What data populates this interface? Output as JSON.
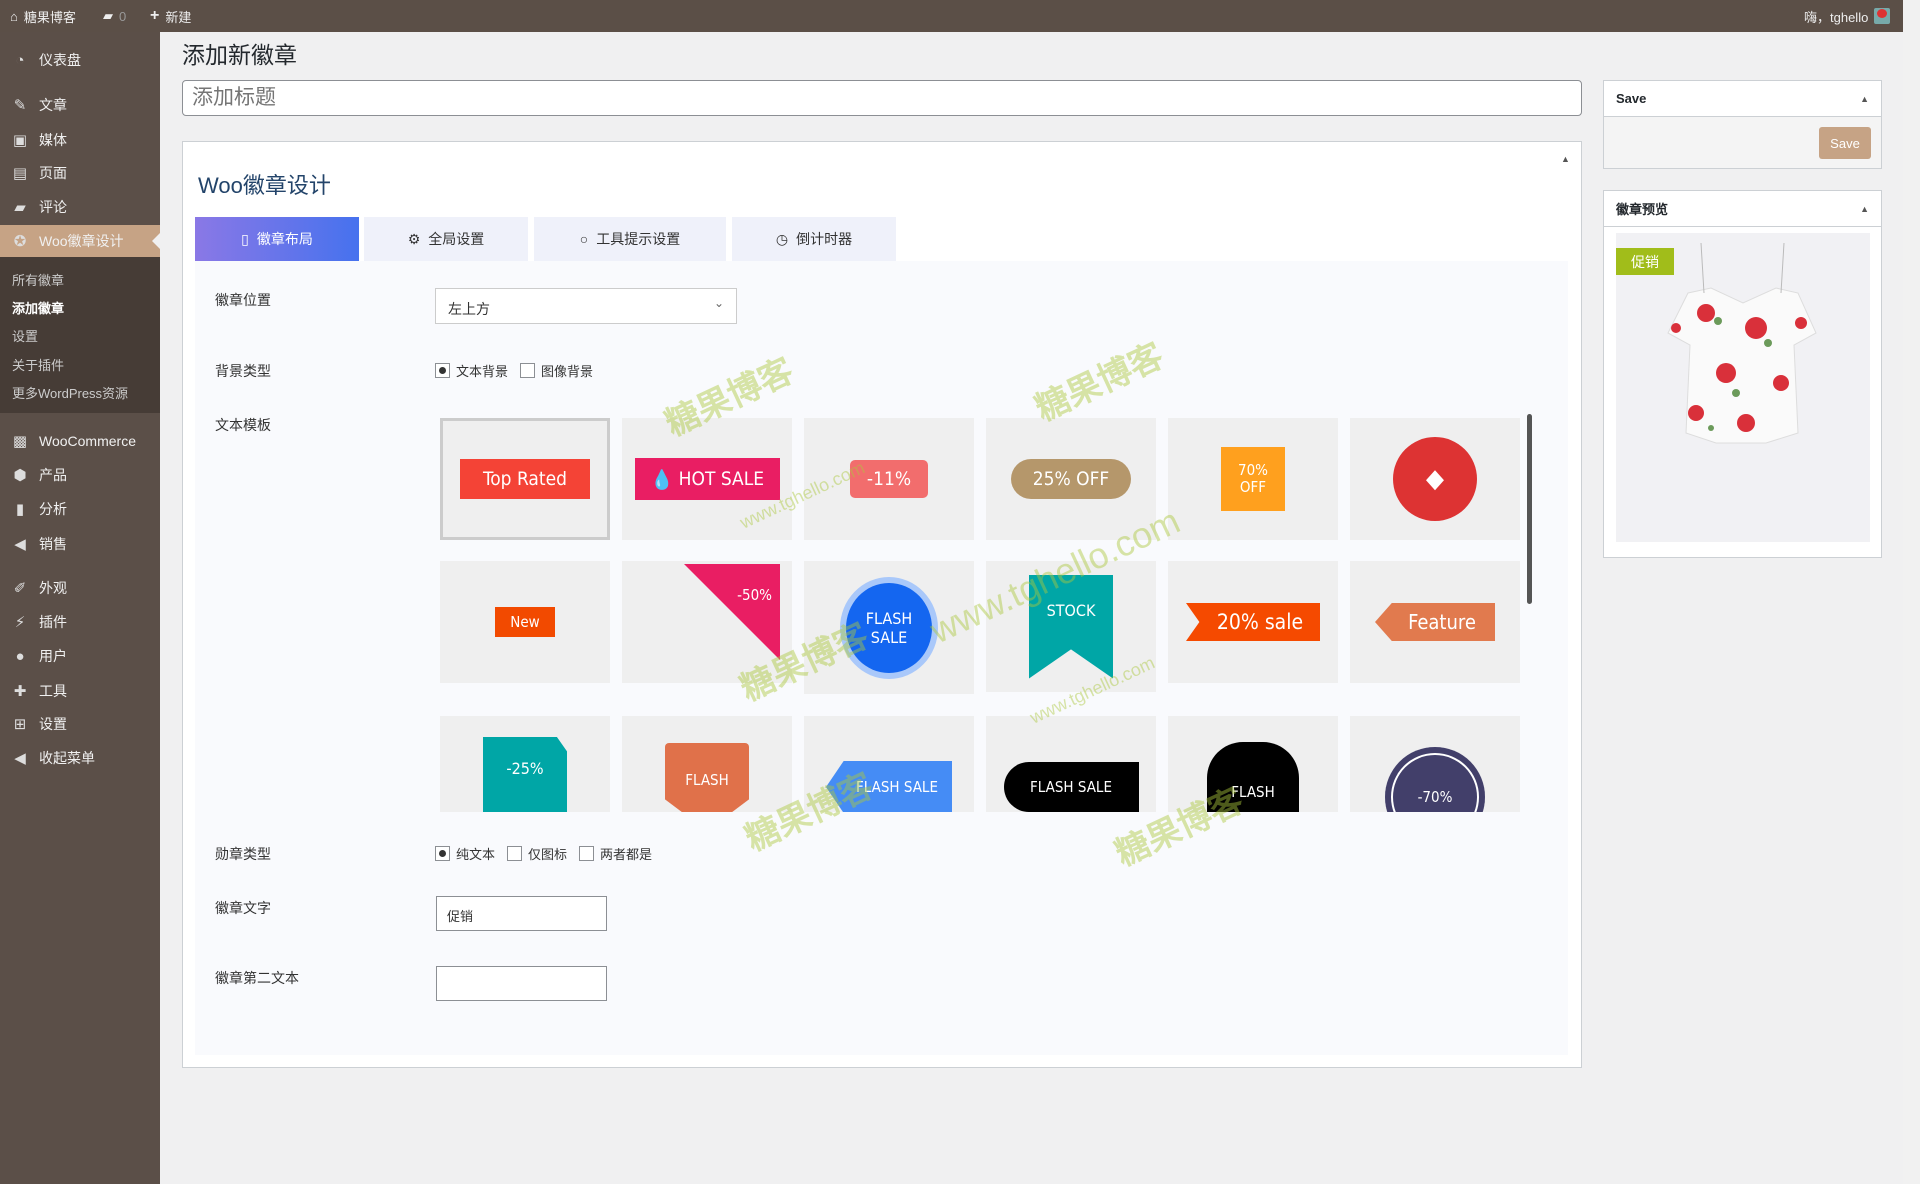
{
  "adminbar": {
    "site": "糖果博客",
    "comments": "0",
    "new": "新建",
    "greeting": "嗨，tghello"
  },
  "sidebar": {
    "items": [
      {
        "label": "仪表盘",
        "icon": "dashboard-icon",
        "glyph": "◔"
      },
      {
        "label": "文章",
        "icon": "pin-icon",
        "glyph": "✎"
      },
      {
        "label": "媒体",
        "icon": "media-icon",
        "glyph": "▣"
      },
      {
        "label": "页面",
        "icon": "page-icon",
        "glyph": "▤"
      },
      {
        "label": "评论",
        "icon": "comment-icon",
        "glyph": "▰"
      },
      {
        "label": "Woo徽章设计",
        "icon": "award-icon",
        "glyph": "✪"
      },
      {
        "label": "WooCommerce",
        "icon": "woo-icon",
        "glyph": "▩"
      },
      {
        "label": "产品",
        "icon": "box-icon",
        "glyph": "⬢"
      },
      {
        "label": "分析",
        "icon": "bar-chart-icon",
        "glyph": "▮"
      },
      {
        "label": "销售",
        "icon": "megaphone-icon",
        "glyph": "◀"
      },
      {
        "label": "外观",
        "icon": "brush-icon",
        "glyph": "✐"
      },
      {
        "label": "插件",
        "icon": "plugin-icon",
        "glyph": "⚡"
      },
      {
        "label": "用户",
        "icon": "user-icon",
        "glyph": "●"
      },
      {
        "label": "工具",
        "icon": "wrench-icon",
        "glyph": "✚"
      },
      {
        "label": "设置",
        "icon": "settings-icon",
        "glyph": "⊞"
      },
      {
        "label": "收起菜单",
        "icon": "collapse-icon",
        "glyph": "◀"
      }
    ],
    "submenu": [
      "所有徽章",
      "添加徽章",
      "设置",
      "关于插件",
      "更多WordPress资源"
    ]
  },
  "page": {
    "title": "添加新徽章",
    "title_placeholder": "添加标题",
    "heading": "Woo徽章设计"
  },
  "tabs": [
    "徽章布局",
    "全局设置",
    "工具提示设置",
    "倒计时器"
  ],
  "form": {
    "position_label": "徽章位置",
    "position_value": "左上方",
    "bg_label": "背景类型",
    "bg_options": [
      "文本背景",
      "图像背景"
    ],
    "template_label": "文本模板",
    "type_label": "勋章类型",
    "type_options": [
      "纯文本",
      "仅图标",
      "两者都是"
    ],
    "text_label": "徽章文字",
    "text_value": "促销",
    "text2_label": "徽章第二文本",
    "text2_value": ""
  },
  "badges": [
    {
      "text": "Top Rated",
      "color": "#f44336"
    },
    {
      "text": "HOT SALE",
      "color": "#e91e63"
    },
    {
      "text": "-11%",
      "color": "#f26d6d"
    },
    {
      "text": "25% OFF",
      "color": "#b5976b"
    },
    {
      "text": "70% OFF",
      "color": "#ffa01e"
    },
    {
      "text": "",
      "color": "#dd3333"
    },
    {
      "text": "New",
      "color": "#f24a00"
    },
    {
      "text": "-50%",
      "color": "#e91e63"
    },
    {
      "text": "FLASH SALE",
      "color": "#1466f0"
    },
    {
      "text": "STOCK",
      "color": "#00a6a6"
    },
    {
      "text": "20% sale",
      "color": "#f54a00"
    },
    {
      "text": "Feature",
      "color": "#e17a4e"
    },
    {
      "text": "-25%",
      "color": "#00a6a6"
    },
    {
      "text": "FLASH",
      "color": "#e0714a"
    },
    {
      "text": "FLASH SALE",
      "color": "#458cf5"
    },
    {
      "text": "FLASH SALE",
      "color": "#000000"
    },
    {
      "text": "FLASH",
      "color": "#000000"
    },
    {
      "text": "-70%",
      "color": "#423f6a"
    }
  ],
  "save": {
    "title": "Save",
    "button": "Save"
  },
  "preview": {
    "title": "徽章预览",
    "badge": "促销"
  },
  "watermarks": [
    "糖果博客",
    "www.tghello.com"
  ],
  "colors": {
    "accent": "#c6a385",
    "adminbar": "#5b4f47",
    "preview_badge": "#a1bd1a"
  }
}
